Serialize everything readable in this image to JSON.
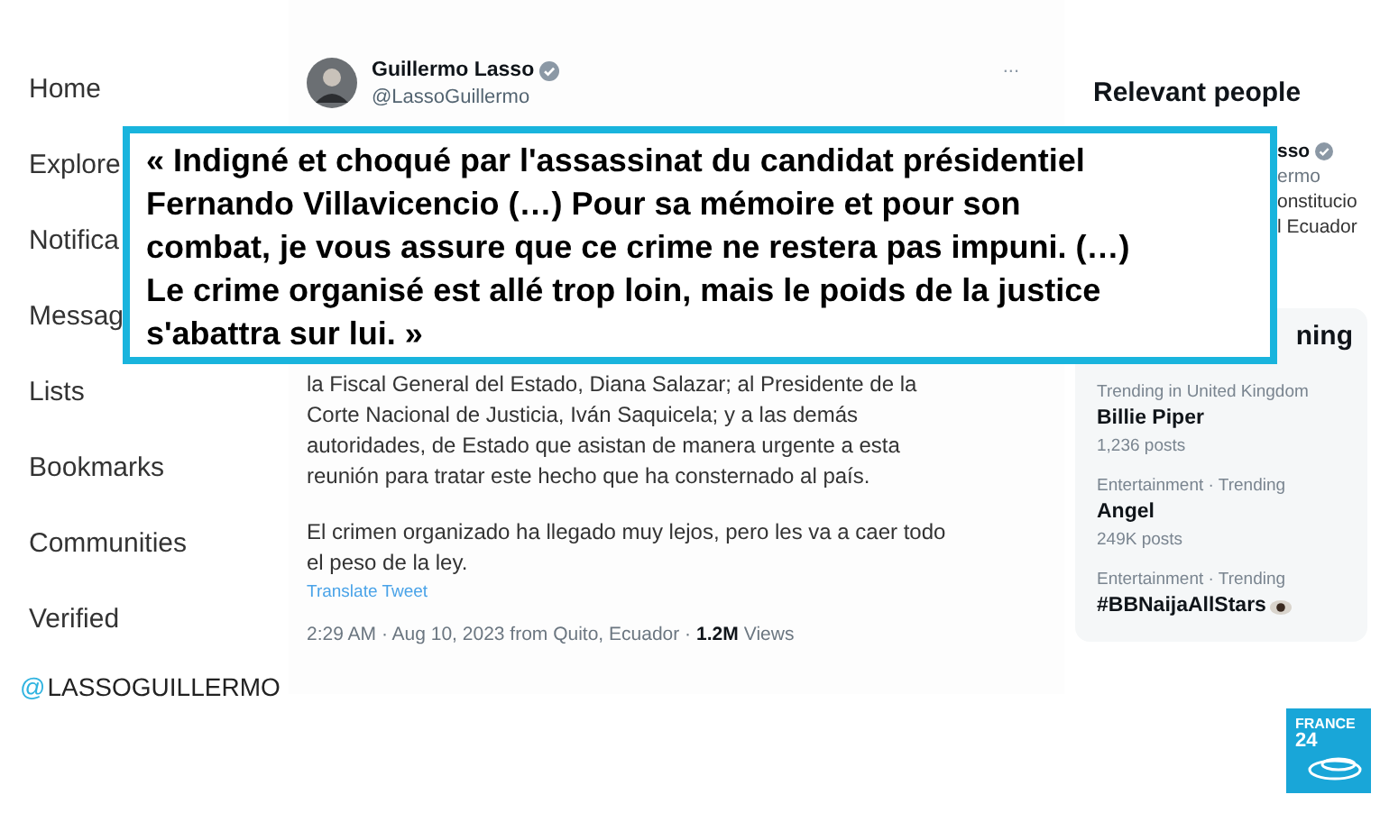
{
  "nav": [
    {
      "label": "Home"
    },
    {
      "label": "Explore"
    },
    {
      "label": "Notifica"
    },
    {
      "label": "Messag"
    },
    {
      "label": "Lists"
    },
    {
      "label": "Bookmarks"
    },
    {
      "label": "Communities"
    },
    {
      "label": "Verified"
    }
  ],
  "tweet": {
    "author": "Guillermo Lasso",
    "verified": true,
    "handle": "@LassoGuillermo",
    "more": "...",
    "paragraphs": [
      [
        "la Fiscal General del Estado, Diana Salazar; al Presidente de la",
        "Corte Nacional de Justicia, Iván Saquicela; y a las demás",
        "autoridades, de Estado que asistan de manera urgente a esta",
        "reunión para tratar este hecho que ha consternado al país."
      ],
      [
        "El crimen organizado ha llegado muy lejos, pero les va a caer todo",
        "el peso de la ley."
      ]
    ],
    "translate": "Translate Tweet",
    "meta": "2:29 AM · Aug 10, 2023 from Quito, Ecuador ·",
    "views_count": "1.2M",
    "views_label": "Views"
  },
  "relevant": {
    "title": "Relevant people",
    "name_part": "sso",
    "verified": true,
    "handle_part": "ermo",
    "bio_lines": [
      "onstitucio",
      "l Ecuador"
    ]
  },
  "trending": {
    "title_part": "ning",
    "items": [
      {
        "context": "Trending in United Kingdom",
        "name": "Billie Piper",
        "count": "1,236 posts"
      },
      {
        "context": "Entertainment · Trending",
        "name": "Angel",
        "count": "249K posts"
      },
      {
        "context": "Entertainment · Trending",
        "name": "#BBNaijaAllStars",
        "has_icon": true
      }
    ]
  },
  "quote": {
    "lines": [
      "« Indigné et choqué par l'assassinat du candidat présidentiel",
      "Fernando Villavicencio (…) Pour sa mémoire et pour son",
      "combat, je vous assure que ce crime ne restera pas impuni. (…)",
      "Le crime organisé est allé trop loin, mais le poids de la justice",
      "s'abattra sur lui. »"
    ]
  },
  "caption": {
    "at": "@",
    "handle": "LASSOGUILLERMO"
  },
  "logo": {
    "line1": "FRANCE",
    "line2": "24"
  }
}
